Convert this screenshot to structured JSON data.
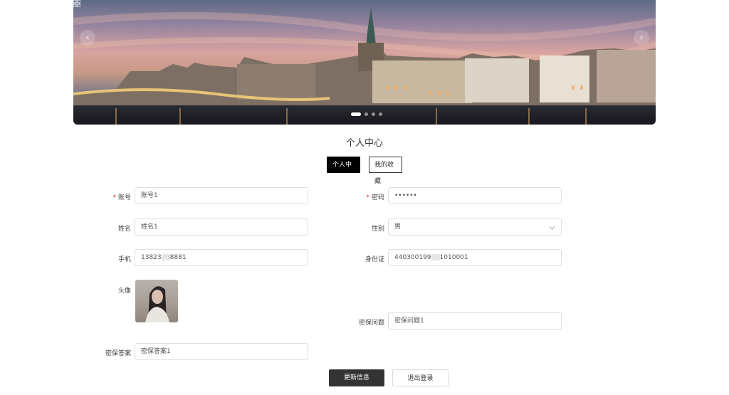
{
  "banner": {
    "prev_glyph": "‹",
    "next_glyph": "›",
    "slide_count": 4,
    "active_slide": 1,
    "corner_icon": "qr-grid-icon"
  },
  "page_title": "个人中心",
  "tabs": [
    {
      "label": "个人中心",
      "active": true
    },
    {
      "label": "我的收藏",
      "active": false
    }
  ],
  "form": {
    "account": {
      "label": "账号",
      "required": true,
      "value": "账号1"
    },
    "password": {
      "label": "密码",
      "required": true,
      "value": "••••••"
    },
    "name": {
      "label": "姓名",
      "value": "姓名1"
    },
    "gender": {
      "label": "性别",
      "value": "男",
      "icon": "chevron-down-icon"
    },
    "phone": {
      "label": "手机",
      "value_a": "13823",
      "value_b": "8881"
    },
    "id_card": {
      "label": "身份证",
      "value_a": "440300199",
      "value_b": "1010001"
    },
    "avatar": {
      "label": "头像"
    },
    "security_question": {
      "label": "密保问题",
      "value": "密保问题1"
    },
    "security_answer": {
      "label": "密保答案",
      "value": "密保答案1"
    }
  },
  "buttons": {
    "update": "更新信息",
    "logout": "退出登录"
  },
  "required_mark": "*",
  "colors": {
    "primary_dark": "#333333",
    "active_tab": "#000000",
    "required": "#e4393c",
    "border": "#dcdfe6"
  }
}
